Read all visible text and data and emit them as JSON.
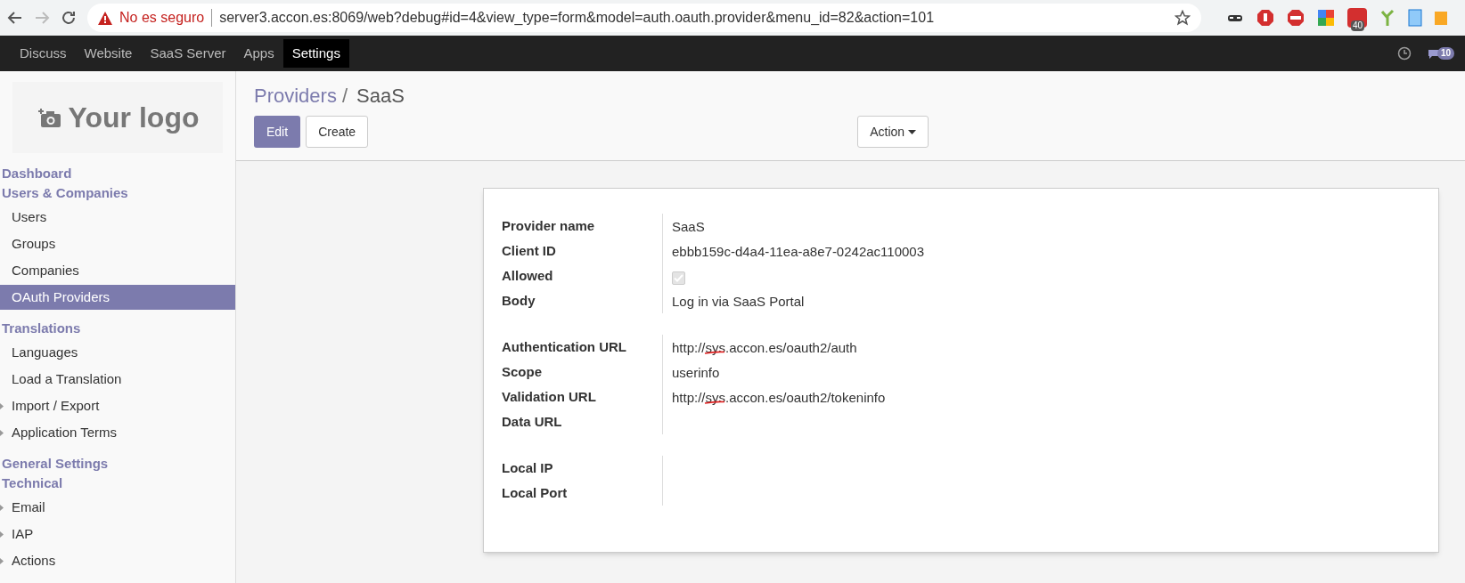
{
  "browser": {
    "security_label": "No es seguro",
    "url": "server3.accon.es:8069/web?debug#id=4&view_type=form&model=auth.oauth.provider&menu_id=82&action=101",
    "extension_badge": "40"
  },
  "top_menu": [
    {
      "label": "Discuss",
      "selected": false
    },
    {
      "label": "Website",
      "selected": false
    },
    {
      "label": "SaaS Server",
      "selected": false
    },
    {
      "label": "Apps",
      "selected": false
    },
    {
      "label": "Settings",
      "selected": true
    }
  ],
  "chat_count": "10",
  "logo": "Your logo",
  "sidebar": [
    {
      "kind": "section",
      "label": "Dashboard"
    },
    {
      "kind": "section",
      "label": "Users & Companies"
    },
    {
      "kind": "item",
      "label": "Users",
      "selected": false,
      "expandable": false
    },
    {
      "kind": "item",
      "label": "Groups",
      "selected": false,
      "expandable": false
    },
    {
      "kind": "item",
      "label": "Companies",
      "selected": false,
      "expandable": false
    },
    {
      "kind": "item",
      "label": "OAuth Providers",
      "selected": true,
      "expandable": false
    },
    {
      "kind": "section",
      "label": "Translations"
    },
    {
      "kind": "item",
      "label": "Languages",
      "selected": false,
      "expandable": false
    },
    {
      "kind": "item",
      "label": "Load a Translation",
      "selected": false,
      "expandable": false
    },
    {
      "kind": "item",
      "label": "Import / Export",
      "selected": false,
      "expandable": true
    },
    {
      "kind": "item",
      "label": "Application Terms",
      "selected": false,
      "expandable": true
    },
    {
      "kind": "section",
      "label": "General Settings"
    },
    {
      "kind": "section",
      "label": "Technical"
    },
    {
      "kind": "item",
      "label": "Email",
      "selected": false,
      "expandable": true
    },
    {
      "kind": "item",
      "label": "IAP",
      "selected": false,
      "expandable": true
    },
    {
      "kind": "item",
      "label": "Actions",
      "selected": false,
      "expandable": true
    }
  ],
  "breadcrumb": [
    "Providers",
    "SaaS"
  ],
  "breadcrumb_separator": "/",
  "buttons": {
    "edit": "Edit",
    "create": "Create",
    "action": "Action"
  },
  "form": {
    "groups": [
      {
        "fields": [
          {
            "label": "Provider name",
            "kind": "text",
            "value": "SaaS"
          },
          {
            "label": "Client ID",
            "kind": "text",
            "value": "ebbb159c-d4a4-11ea-a8e7-0242ac110003"
          },
          {
            "label": "Allowed",
            "kind": "checkbox",
            "checked": true
          },
          {
            "label": "Body",
            "kind": "text",
            "value": "Log in via SaaS Portal"
          }
        ]
      },
      {
        "fields": [
          {
            "label": "Authentication URL",
            "kind": "text",
            "value": "http://sys.accon.es/oauth2/auth",
            "annotated": true
          },
          {
            "label": "Scope",
            "kind": "text",
            "value": "userinfo"
          },
          {
            "label": "Validation URL",
            "kind": "text",
            "value": "http://sys.accon.es/oauth2/tokeninfo",
            "annotated": true
          },
          {
            "label": "Data URL",
            "kind": "text"
          }
        ]
      },
      {
        "fields": [
          {
            "label": "Local IP",
            "kind": "text"
          },
          {
            "label": "Local Port",
            "kind": "text"
          }
        ]
      }
    ]
  }
}
